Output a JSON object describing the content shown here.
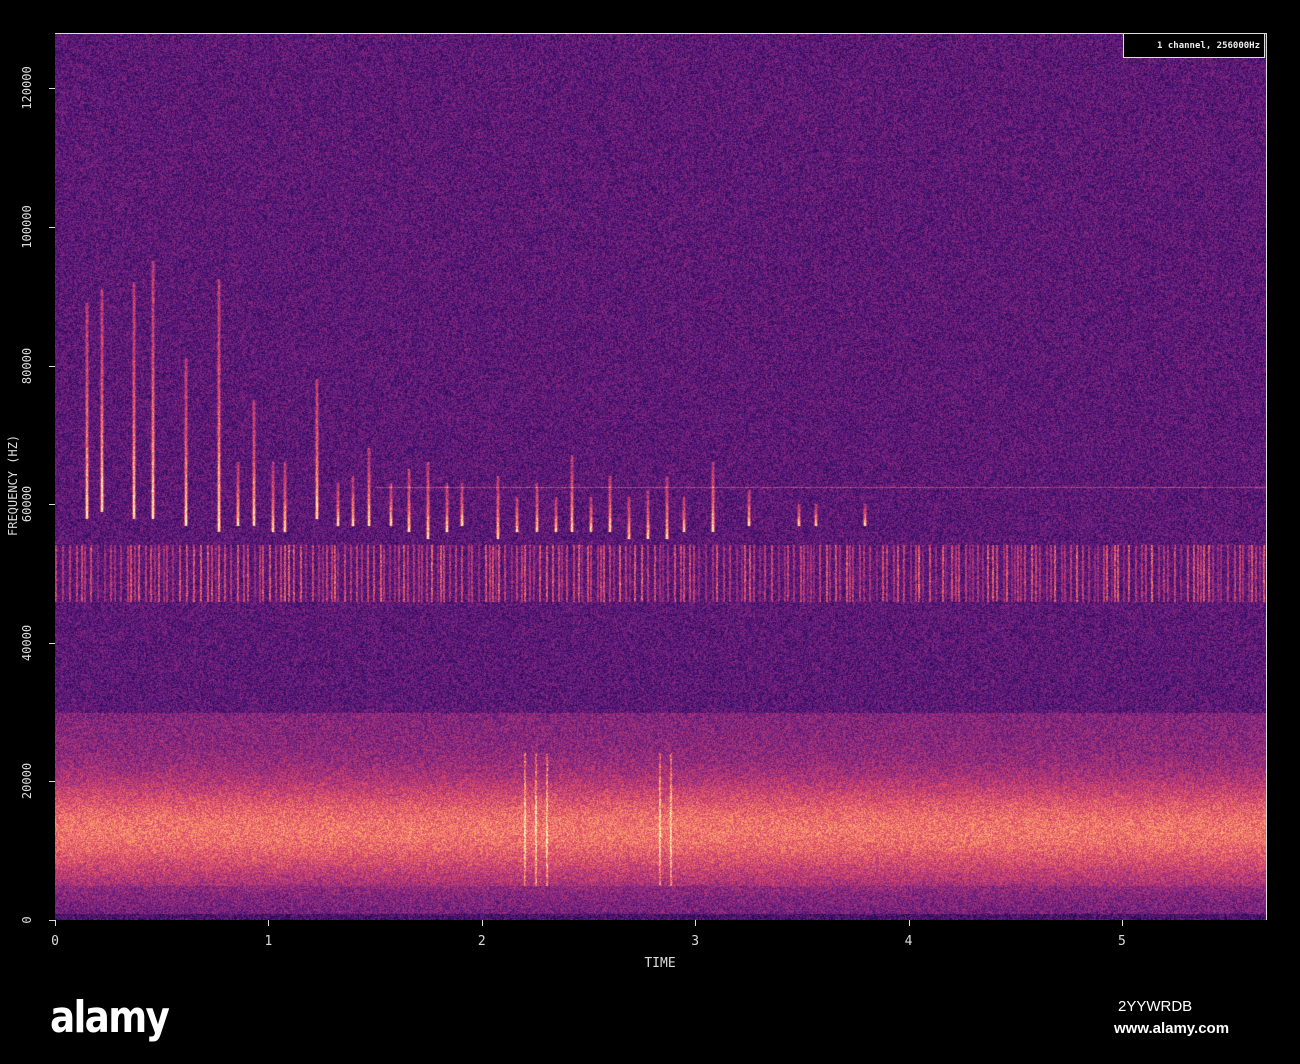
{
  "chart_data": {
    "type": "heatmap",
    "subtype": "spectrogram",
    "xlabel": "TIME",
    "ylabel": "FREQUENCY (HZ)",
    "xlim": [
      0,
      5.68
    ],
    "ylim": [
      0,
      128000
    ],
    "xticks": [
      0,
      1,
      2,
      3,
      4,
      5
    ],
    "yticks": [
      0,
      20000,
      40000,
      60000,
      80000,
      100000,
      120000
    ],
    "legend": {
      "text": "1 channel, 256000Hz",
      "position": "top-right"
    },
    "colormap": [
      "#000004",
      "#3b0f70",
      "#8c2981",
      "#de4968",
      "#fe9f6d",
      "#fcfdbf"
    ],
    "bands": [
      {
        "name": "low-frequency noise band",
        "fmin": 5000,
        "fmax": 26000,
        "peak": 13000
      },
      {
        "name": "pulsed band",
        "fmin": 46000,
        "fmax": 54000
      },
      {
        "name": "tonal line",
        "fmin": 62500,
        "fmax": 62500,
        "tmin": 1.5,
        "tmax": 5.68
      }
    ],
    "calls": [
      {
        "t": 0.145,
        "fmin": 58000,
        "fmax": 89000
      },
      {
        "t": 0.216,
        "fmin": 59000,
        "fmax": 91000
      },
      {
        "t": 0.366,
        "fmin": 58000,
        "fmax": 92000
      },
      {
        "t": 0.455,
        "fmin": 58000,
        "fmax": 95000
      },
      {
        "t": 0.609,
        "fmin": 57000,
        "fmax": 81000
      },
      {
        "t": 0.764,
        "fmin": 56000,
        "fmax": 92500
      },
      {
        "t": 0.853,
        "fmin": 57000,
        "fmax": 66000
      },
      {
        "t": 0.928,
        "fmin": 57000,
        "fmax": 75000
      },
      {
        "t": 1.017,
        "fmin": 56000,
        "fmax": 66000
      },
      {
        "t": 1.074,
        "fmin": 56000,
        "fmax": 66000
      },
      {
        "t": 1.224,
        "fmin": 58000,
        "fmax": 78000
      },
      {
        "t": 1.322,
        "fmin": 57000,
        "fmax": 63000
      },
      {
        "t": 1.392,
        "fmin": 57000,
        "fmax": 64000
      },
      {
        "t": 1.467,
        "fmin": 57000,
        "fmax": 68000
      },
      {
        "t": 1.571,
        "fmin": 57000,
        "fmax": 63000
      },
      {
        "t": 1.655,
        "fmin": 56000,
        "fmax": 65000
      },
      {
        "t": 1.744,
        "fmin": 55000,
        "fmax": 66000
      },
      {
        "t": 1.833,
        "fmin": 56000,
        "fmax": 63000
      },
      {
        "t": 1.903,
        "fmin": 57000,
        "fmax": 63000
      },
      {
        "t": 2.072,
        "fmin": 55000,
        "fmax": 64000
      },
      {
        "t": 2.161,
        "fmin": 56000,
        "fmax": 61000
      },
      {
        "t": 2.255,
        "fmin": 56000,
        "fmax": 63000
      },
      {
        "t": 2.344,
        "fmin": 56000,
        "fmax": 61000
      },
      {
        "t": 2.419,
        "fmin": 56000,
        "fmax": 67000
      },
      {
        "t": 2.508,
        "fmin": 56000,
        "fmax": 61000
      },
      {
        "t": 2.597,
        "fmin": 56000,
        "fmax": 64000
      },
      {
        "t": 2.686,
        "fmin": 55000,
        "fmax": 61000
      },
      {
        "t": 2.775,
        "fmin": 55000,
        "fmax": 62000
      },
      {
        "t": 2.865,
        "fmin": 55000,
        "fmax": 64000
      },
      {
        "t": 2.944,
        "fmin": 56000,
        "fmax": 61000
      },
      {
        "t": 3.08,
        "fmin": 56000,
        "fmax": 66000
      },
      {
        "t": 3.25,
        "fmin": 57000,
        "fmax": 62000
      },
      {
        "t": 3.48,
        "fmin": 57000,
        "fmax": 60000
      },
      {
        "t": 3.56,
        "fmin": 57000,
        "fmax": 60000
      },
      {
        "t": 3.79,
        "fmin": 57000,
        "fmax": 60000
      }
    ],
    "broadband_clicks": [
      2.2,
      2.25,
      2.3,
      2.83,
      2.88
    ]
  },
  "footer": {
    "brand": "alamy",
    "image_code": "2YYWRDB",
    "url": "www.alamy.com"
  },
  "watermark": "alamy"
}
